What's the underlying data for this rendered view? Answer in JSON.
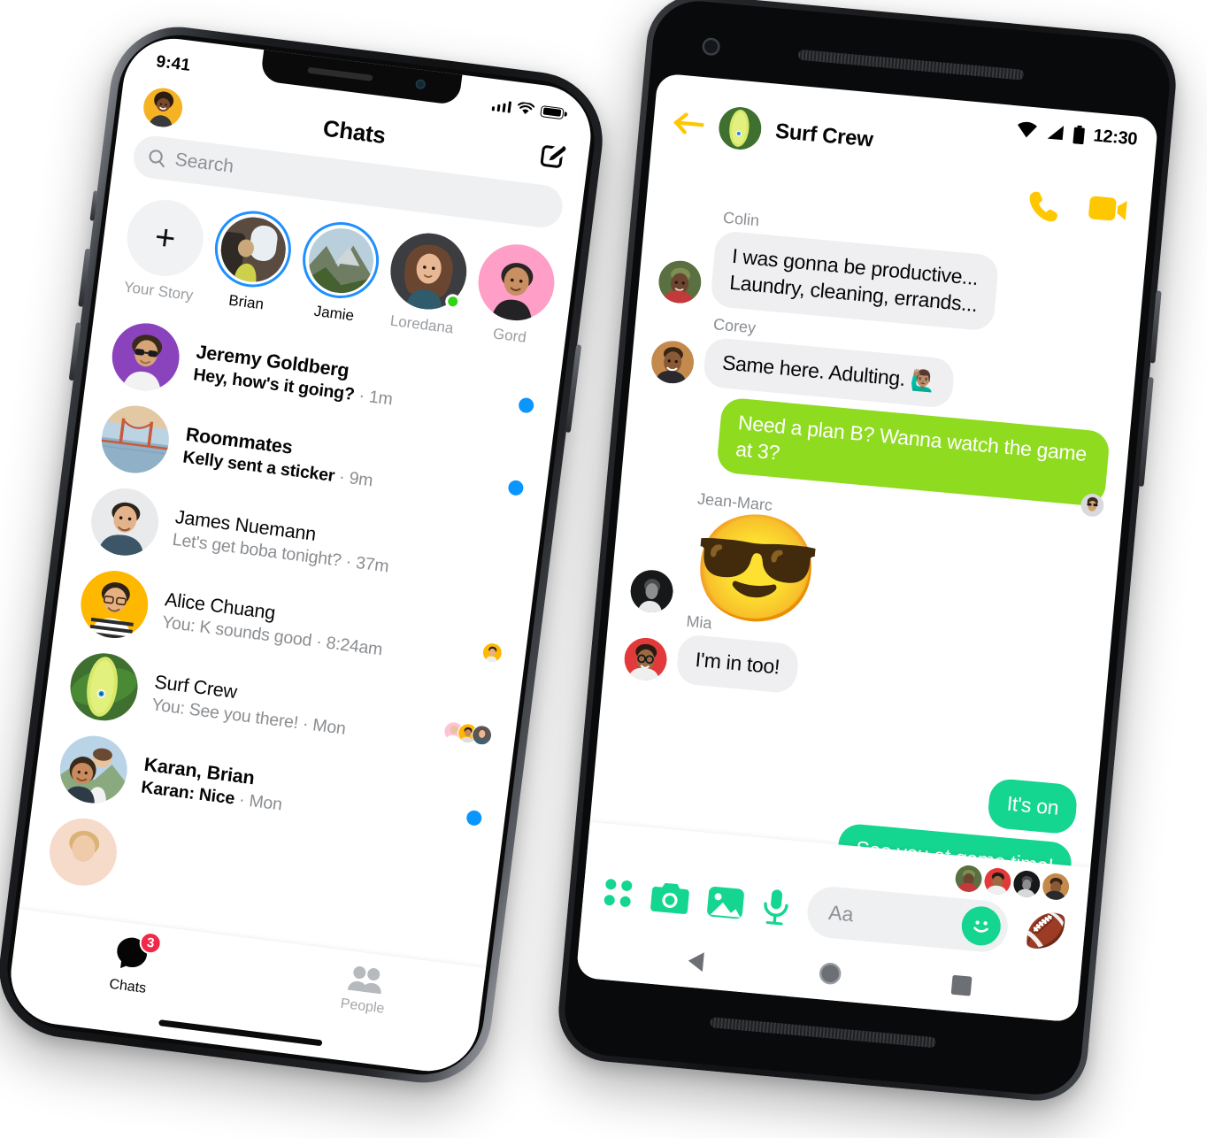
{
  "iphone": {
    "status": {
      "time": "9:41",
      "signal_icon": "cellular-bars-icon",
      "wifi_icon": "wifi-icon",
      "battery_icon": "battery-full-icon"
    },
    "header": {
      "title": "Chats",
      "avatar_name": "user-avatar",
      "compose_icon": "compose-pencil-icon"
    },
    "search": {
      "placeholder": "Search",
      "icon": "search-icon"
    },
    "stories": [
      {
        "label": "Your Story",
        "type": "add",
        "icon": "plus-icon",
        "ring": false,
        "online": false,
        "muted": true
      },
      {
        "label": "Brian",
        "type": "photo",
        "ring": true,
        "online": false,
        "muted": false
      },
      {
        "label": "Jamie",
        "type": "photo",
        "ring": true,
        "online": false,
        "muted": false
      },
      {
        "label": "Loredana",
        "type": "photo",
        "ring": false,
        "online": true,
        "muted": true
      },
      {
        "label": "Gord",
        "type": "photo",
        "ring": false,
        "online": false,
        "muted": true
      }
    ],
    "chats": [
      {
        "name": "Jeremy Goldberg",
        "snippet": "Hey, how's it going?",
        "time": "1m",
        "unread": true,
        "meta": "dot"
      },
      {
        "name": "Roommates",
        "snippet": "Kelly sent a sticker",
        "time": "9m",
        "unread": true,
        "meta": "dot"
      },
      {
        "name": "James Nuemann",
        "snippet": "Let's get boba tonight?",
        "time": "37m",
        "unread": false,
        "meta": "none"
      },
      {
        "name": "Alice Chuang",
        "snippet": "You: K sounds good",
        "time": "8:24am",
        "unread": false,
        "meta": "seen1"
      },
      {
        "name": "Surf Crew",
        "snippet": "You: See you there!",
        "time": "Mon",
        "unread": false,
        "meta": "seen3"
      },
      {
        "name": "Karan, Brian",
        "snippet": "Karan: Nice",
        "time": "Mon",
        "unread": true,
        "meta": "dot"
      }
    ],
    "tabs": [
      {
        "label": "Chats",
        "icon": "chat-bubble-icon",
        "badge": "3",
        "active": true
      },
      {
        "label": "People",
        "icon": "people-icon",
        "badge": "",
        "active": false
      }
    ]
  },
  "android": {
    "status": {
      "time": "12:30",
      "wifi_icon": "wifi-icon",
      "signal_icon": "signal-icon",
      "battery_icon": "battery-icon"
    },
    "header": {
      "title": "Surf Crew",
      "back_icon": "back-arrow-icon",
      "avatar_name": "surf-crew-avatar",
      "call_icon": "phone-call-icon",
      "video_icon": "video-camera-icon"
    },
    "messages": [
      {
        "sender": "Colin",
        "text": "I was gonna be productive...\nLaundry, cleaning, errands...",
        "side": "in",
        "style": "grey",
        "avatar": true
      },
      {
        "sender": "Corey",
        "text": "Same here. Adulting. 🙋🏽‍♂️",
        "side": "in",
        "style": "grey",
        "avatar": true
      },
      {
        "sender": "",
        "text": "Need a plan B? Wanna watch the game at 3?",
        "side": "out",
        "style": "lime",
        "avatar": false,
        "reaction_avatar": true
      },
      {
        "sender": "Jean-Marc",
        "text": "😎",
        "side": "in",
        "style": "sticker",
        "avatar": true
      },
      {
        "sender": "Mia",
        "text": "I'm in too!",
        "side": "in",
        "style": "grey",
        "avatar": true
      },
      {
        "sender": "",
        "text": "It's on",
        "side": "out",
        "style": "emerald",
        "avatar": false,
        "reaction_avatar": false
      },
      {
        "sender": "",
        "text": "See you at game time!",
        "side": "out",
        "style": "emerald",
        "avatar": false,
        "reaction_avatar": false
      }
    ],
    "composer": {
      "placeholder": "Aa",
      "more_icon": "four-dots-icon",
      "camera_icon": "camera-icon",
      "gallery_icon": "photo-gallery-icon",
      "mic_icon": "microphone-icon",
      "emoji_icon": "smiley-face-icon",
      "sticker_icon": "football-icon"
    },
    "nav": {
      "back_icon": "nav-back-triangle-icon",
      "home_icon": "nav-home-circle-icon",
      "recents_icon": "nav-recents-square-icon"
    }
  },
  "colors": {
    "messenger_blue": "#0a95ff",
    "story_ring": "#1e90ff",
    "lime_bubble": "#8fdb1f",
    "emerald_bubble": "#14d690",
    "android_yellow": "#ffc700",
    "badge_red": "#f02849",
    "online_green": "#31d411",
    "bubble_grey": "#efeff1"
  }
}
